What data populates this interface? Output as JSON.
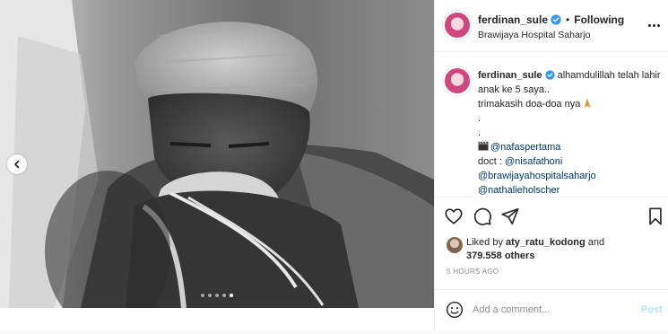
{
  "post": {
    "author": "ferdinan_sule",
    "separator": "•",
    "follow_status": "Following",
    "location": "Brawijaya Hospital Saharjo"
  },
  "caption": {
    "author": "ferdinan_sule",
    "line1": "alhamdulillah telah lahir",
    "line2": "anak ke 5 saya..",
    "line3": "trimakasih doa-doa nya",
    "dot1": ".",
    "dot2": ".",
    "mention_photo": "@nafaspertama",
    "doct_prefix": "doct : ",
    "mention_doct": "@nisafathoni",
    "mention_hospital": "@brawijayahospitalsaharjo",
    "mention_nathalie": "@nathalieholscher"
  },
  "likes": {
    "prefix": "Liked by ",
    "user": "aty_ratu_kodong",
    "joiner": " and",
    "count": "379.558 others"
  },
  "timestamp": "5 HOURS AGO",
  "comment": {
    "placeholder": "Add a comment...",
    "post_label": "Post"
  },
  "carousel": {
    "slide_count": 5,
    "active_index": 4
  },
  "colors": {
    "link": "#00376b",
    "verified": "#3897f0",
    "post_disabled": "#b2dffc",
    "muted": "#8e8e8e"
  },
  "icons": {
    "like": "heart-icon",
    "comment": "comment-icon",
    "share": "paper-plane-icon",
    "save": "bookmark-icon",
    "emoji": "smiley-icon",
    "prev": "chevron-left-icon",
    "options": "more-options-icon"
  }
}
